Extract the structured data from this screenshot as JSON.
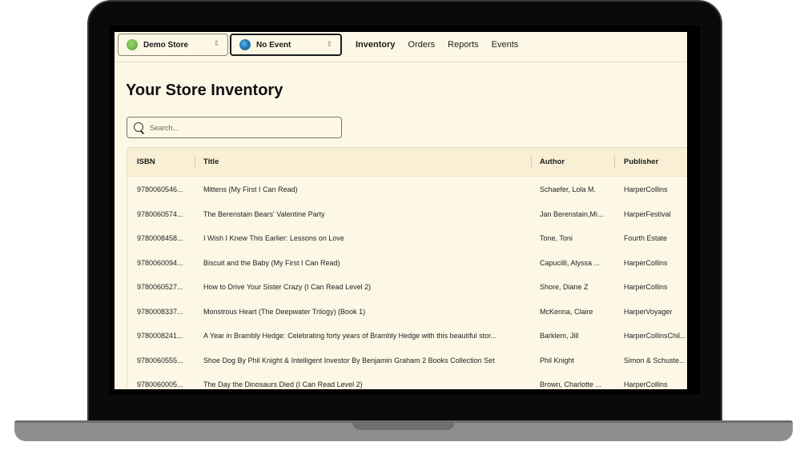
{
  "store_select": {
    "label": "Demo Store"
  },
  "event_select": {
    "label": "No Event"
  },
  "nav": {
    "items": [
      {
        "label": "Inventory",
        "active": true
      },
      {
        "label": "Orders",
        "active": false
      },
      {
        "label": "Reports",
        "active": false
      },
      {
        "label": "Events",
        "active": false
      }
    ]
  },
  "page": {
    "title": "Your Store Inventory"
  },
  "search": {
    "placeholder": "Search..."
  },
  "table": {
    "columns": {
      "isbn": "ISBN",
      "title": "Title",
      "author": "Author",
      "publisher": "Publisher"
    },
    "rows": [
      {
        "isbn": "9780060546...",
        "title": "Mittens (My First I Can Read)",
        "author": "Schaefer, Lola M.",
        "publisher": "HarperCollins"
      },
      {
        "isbn": "9780060574...",
        "title": "The Berenstain Bears' Valentine Party",
        "author": "Jan Berenstain,Mi...",
        "publisher": "HarperFestival"
      },
      {
        "isbn": "9780008458...",
        "title": "I Wish I Knew This Earlier: Lessons on Love",
        "author": "Tone, Toni",
        "publisher": "Fourth Estate"
      },
      {
        "isbn": "9780060094...",
        "title": "Biscuit and the Baby (My First I Can Read)",
        "author": "Capucilli, Alyssa ...",
        "publisher": "HarperCollins"
      },
      {
        "isbn": "9780060527...",
        "title": "How to Drive Your Sister Crazy (I Can Read Level 2)",
        "author": "Shore, Diane Z",
        "publisher": "HarperCollins"
      },
      {
        "isbn": "9780008337...",
        "title": "Monstrous Heart (The Deepwater Trilogy) (Book 1)",
        "author": "McKenna, Claire",
        "publisher": "HarperVoyager"
      },
      {
        "isbn": "9780008241...",
        "title": "A Year in Brambly Hedge: Celebrating forty years of Brambly Hedge with this beautiful stor...",
        "author": "Barklem, Jill",
        "publisher": "HarperCollinsChil..."
      },
      {
        "isbn": "9780060555...",
        "title": "Shoe Dog By Phil Knight & Intelligent Investor By Benjamin Graham 2 Books Collection Set",
        "author": "Phil Knight",
        "publisher": "Simon & Schuste..."
      },
      {
        "isbn": "9780060005...",
        "title": "The Day the Dinosaurs Died (I Can Read Level 2)",
        "author": "Brown, Charlotte ...",
        "publisher": "HarperCollins"
      }
    ]
  }
}
